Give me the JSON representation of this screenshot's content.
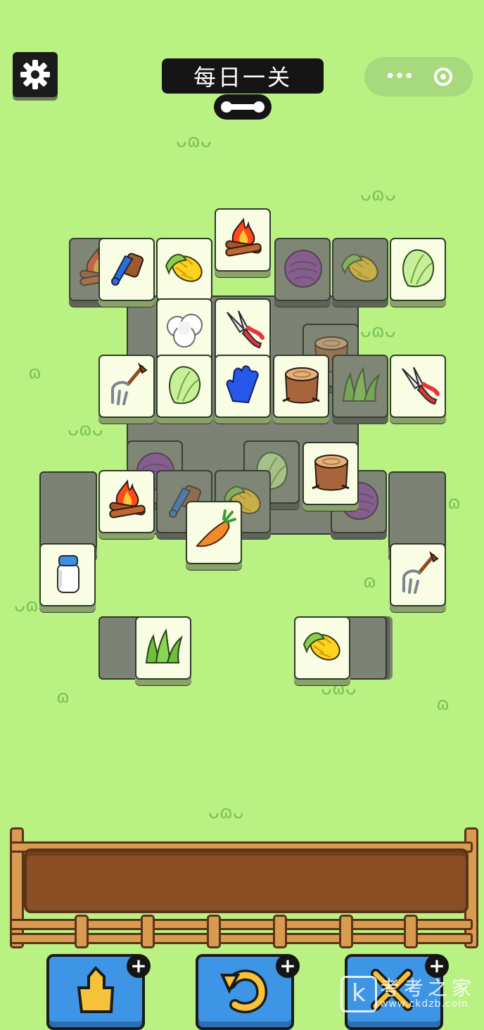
{
  "header": {
    "title": "每日一关",
    "settings_icon": "gear-icon",
    "capsule_more_icon": "more-dots-icon",
    "capsule_close_icon": "close-target-icon"
  },
  "board": {
    "tiles": [
      {
        "item": "campfire",
        "state": "covered"
      },
      {
        "item": "brush",
        "state": "free"
      },
      {
        "item": "corn",
        "state": "free"
      },
      {
        "item": "campfire",
        "state": "free"
      },
      {
        "item": "cabbage",
        "state": "covered"
      },
      {
        "item": "corn",
        "state": "covered"
      },
      {
        "item": "napa-cabbage",
        "state": "free"
      },
      {
        "item": "cotton",
        "state": "free"
      },
      {
        "item": "shears",
        "state": "free"
      },
      {
        "item": "stump",
        "state": "covered"
      },
      {
        "item": "fork",
        "state": "free"
      },
      {
        "item": "napa-cabbage",
        "state": "free"
      },
      {
        "item": "glove",
        "state": "free"
      },
      {
        "item": "stump",
        "state": "free"
      },
      {
        "item": "grass",
        "state": "covered"
      },
      {
        "item": "shears",
        "state": "free"
      },
      {
        "item": "cabbage",
        "state": "covered"
      },
      {
        "item": "napa-cabbage",
        "state": "covered"
      },
      {
        "item": "stump",
        "state": "free"
      },
      {
        "item": "campfire",
        "state": "free"
      },
      {
        "item": "brush",
        "state": "covered"
      },
      {
        "item": "carrot",
        "state": "free"
      },
      {
        "item": "corn",
        "state": "covered"
      },
      {
        "item": "cabbage",
        "state": "covered"
      },
      {
        "item": "milk",
        "state": "free"
      },
      {
        "item": "fork",
        "state": "free"
      },
      {
        "item": "grass",
        "state": "free"
      },
      {
        "item": "corn",
        "state": "free"
      }
    ]
  },
  "tray": {
    "slots": []
  },
  "toolbar": {
    "buttons": [
      {
        "icon": "shift-out-icon",
        "plus": "+"
      },
      {
        "icon": "undo-icon",
        "plus": "+"
      },
      {
        "icon": "shuffle-icon",
        "plus": "+"
      }
    ]
  },
  "watermark": {
    "letter": "k",
    "text": "考考之家",
    "url": "www.ckdzb.com"
  },
  "colors": {
    "background": "#b9f283",
    "tile_face": "#f8fde3",
    "tile_covered": "#7f8676",
    "tool_button": "#3e95e6",
    "tray": "#8a4f24"
  }
}
